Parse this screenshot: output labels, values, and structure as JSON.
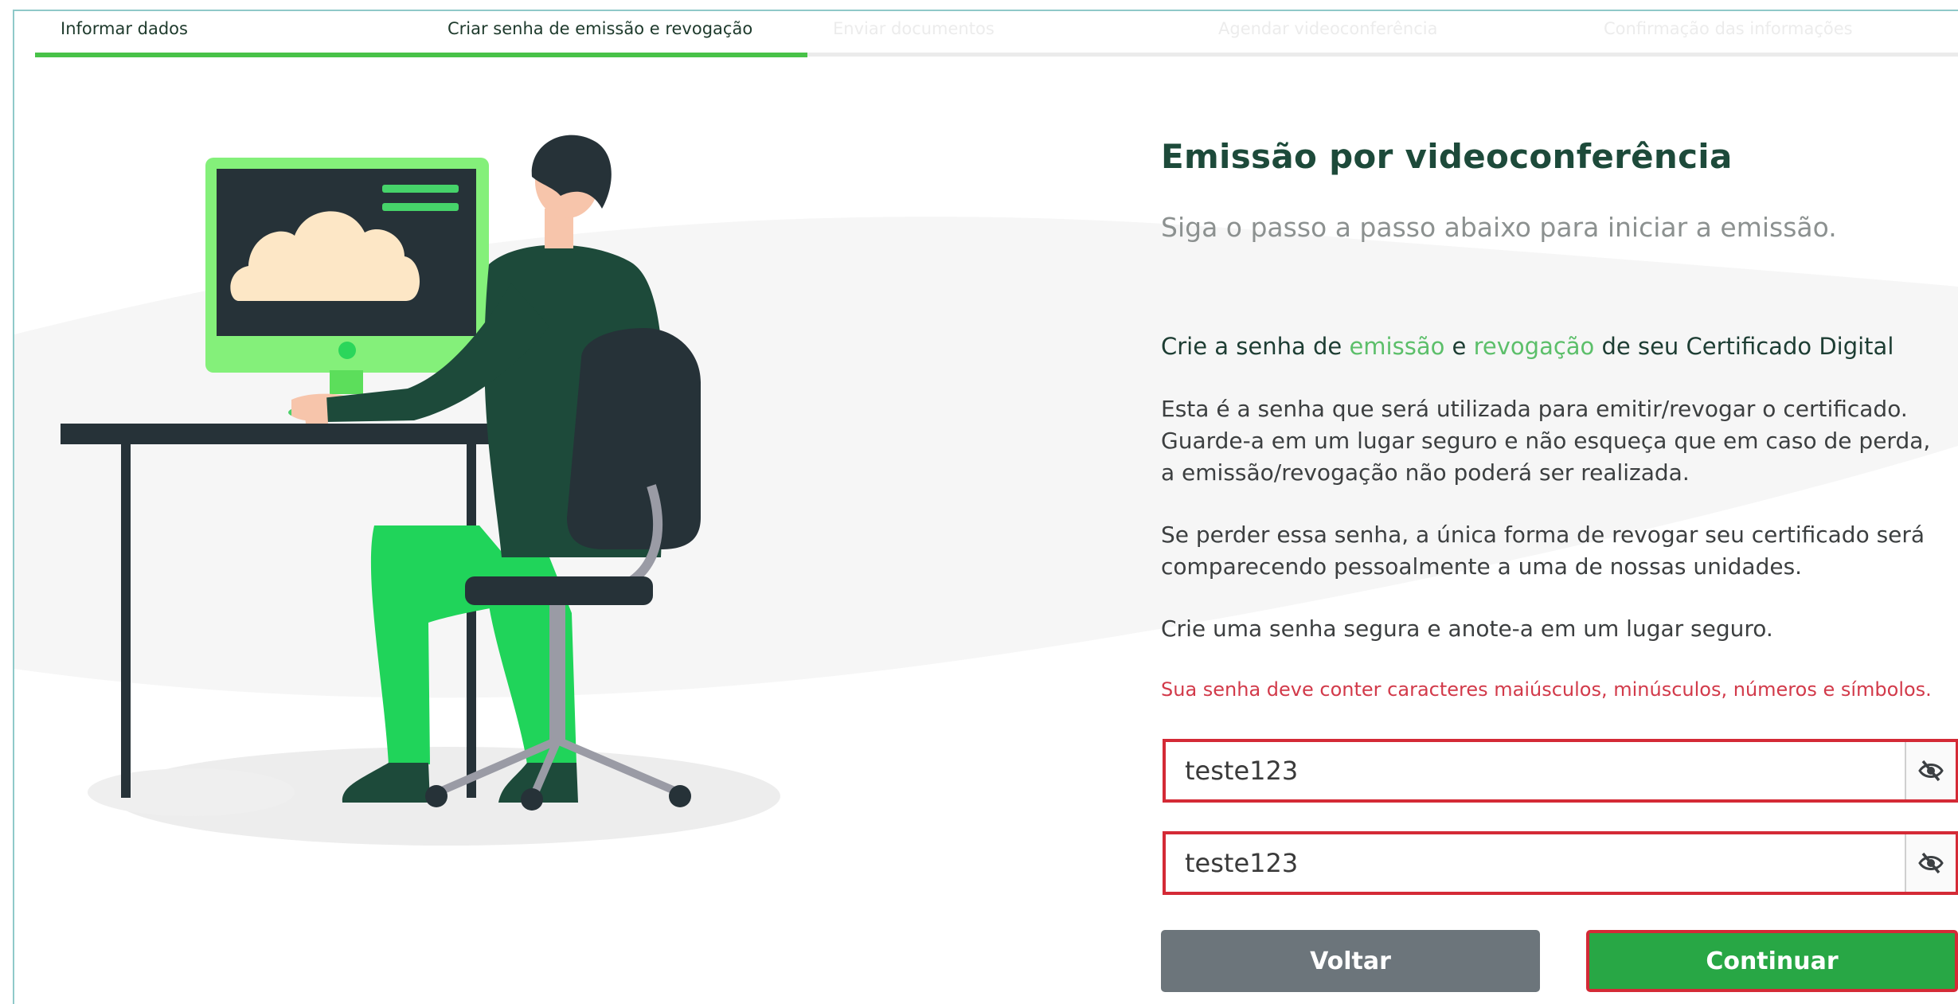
{
  "stepper": {
    "steps": [
      {
        "label": "Informar dados"
      },
      {
        "label": "Criar senha de emissão e revogação"
      },
      {
        "label": "Enviar documentos"
      },
      {
        "label": "Agendar videoconferência"
      },
      {
        "label": "Confirmação das informações"
      }
    ]
  },
  "main": {
    "title": "Emissão por videoconferência",
    "subtitle": "Siga o passo a passo abaixo para iniciar a emissão.",
    "heading": {
      "part1": "Crie a senha de ",
      "emissao": "emissão",
      "part2": " e ",
      "revogacao": "revogação",
      "part3": " de seu Certificado Digital"
    },
    "paragraph1": "Esta é a senha que será utilizada para emitir/revogar o certificado. Guarde-a em um lugar seguro e não esqueça que em caso de perda, a emissão/revogação não poderá ser realizada.",
    "paragraph2": "Se perder essa senha, a única forma de revogar seu certificado será comparecendo pessoalmente a uma de nossas unidades.",
    "paragraph3": "Crie uma senha segura e anote-a em um lugar seguro.",
    "warning": "Sua senha deve conter caracteres maiúsculos, minúsculos, números e símbolos."
  },
  "form": {
    "password": "teste123",
    "confirm_password": "teste123",
    "toggle_icon": "eye-slash-icon"
  },
  "buttons": {
    "back": "Voltar",
    "next": "Continuar"
  },
  "colors": {
    "brand_dark": "#1d4a3a",
    "accent_green": "#48c248",
    "warning_red": "#d23a4a",
    "continue_bg": "#28a745",
    "back_bg": "#6c757b"
  }
}
